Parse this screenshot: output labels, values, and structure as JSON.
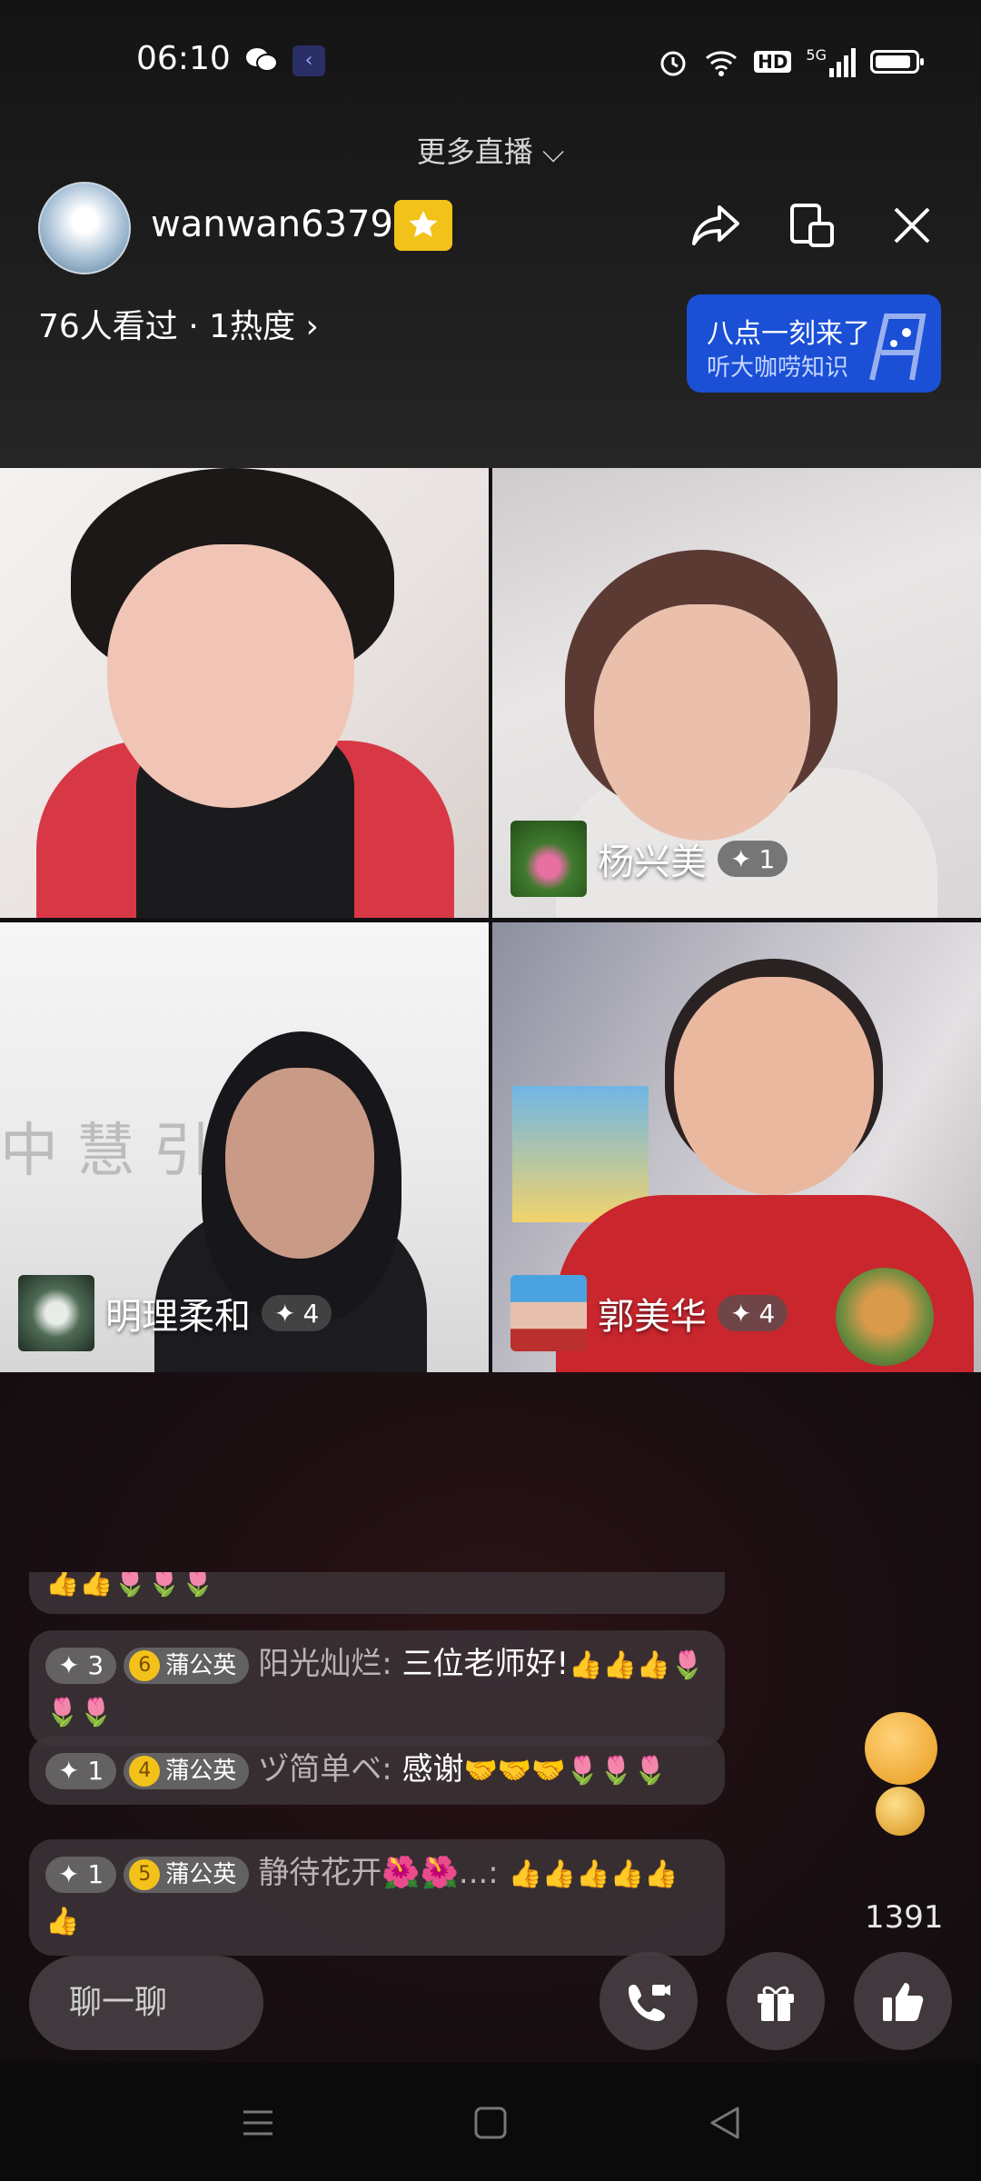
{
  "status_bar": {
    "time": "06:10",
    "icons": [
      "wechat-icon",
      "app-notification-icon",
      "alarm-icon",
      "wifi-icon",
      "hd-icon",
      "5g-signal-icon",
      "battery-icon"
    ],
    "hd": "HD",
    "network": "5G"
  },
  "header": {
    "more_live_label": "更多直播 ⌵",
    "host_name": "wanwan6379",
    "viewers": "76人看过 · 1热度 ›",
    "promo_title": "八点一刻来了",
    "promo_subtitle": "听大咖唠知识"
  },
  "participants": [
    {
      "name": "杨兴美",
      "level": "1"
    },
    {
      "name": "明理柔和",
      "level": "4"
    },
    {
      "name": "郭美华",
      "level": "4"
    }
  ],
  "comments": [
    {
      "level": "3",
      "fan_level": "6",
      "fan_name": "蒲公英",
      "user": "阳光灿烂:",
      "text": "三位老师好!",
      "emojis": "👍👍👍🌷🌷🌷"
    },
    {
      "level": "1",
      "fan_level": "4",
      "fan_name": "蒲公英",
      "user": "ヅ简单ベ:",
      "text": "感谢",
      "emojis": "🤝🤝🤝🌷🌷🌷"
    },
    {
      "level": "1",
      "fan_level": "5",
      "fan_name": "蒲公英",
      "user": "静待花开🌺🌺...:",
      "text": "",
      "emojis": "👍👍👍👍👍👍"
    }
  ],
  "partial_comment_emojis": "👍👍🌷🌷🌷",
  "bottom_bar": {
    "input_placeholder": "聊一聊",
    "like_count": "1391"
  },
  "colors": {
    "accent_gold": "#f3c21a",
    "promo_blue": "#1a4fd6"
  }
}
